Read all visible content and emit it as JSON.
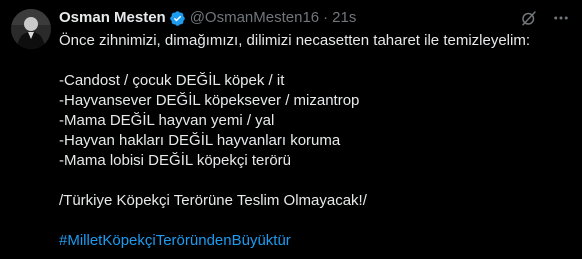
{
  "tweet": {
    "display_name": "Osman Mesten",
    "handle": "@OsmanMesten16",
    "separator": "·",
    "time": "21s",
    "lines": {
      "l1": "Önce zihnimizi, dimağımızı, dilimizi necasetten taharet ile temizleyelim:",
      "l2": "-Candost / çocuk DEĞİL köpek / it",
      "l3": "-Hayvansever DEĞİL köpeksever / mizantrop",
      "l4": "-Mama DEĞİL hayvan yemi / yal",
      "l5": "-Hayvan hakları DEĞİL hayvanları koruma",
      "l6": "-Mama lobisi DEĞİL köpekçi terörü",
      "l7": "/Türkiye Köpekçi Terörüne Teslim Olmayacak!/"
    },
    "hashtag": "#MilletKöpekçiTeröründenBüyüktür"
  },
  "icons": {
    "verified": "verified-badge-icon",
    "grok": "grok-icon",
    "more": "more-options-icon"
  },
  "colors": {
    "background": "#000000",
    "text": "#e7e9ea",
    "muted": "#71767b",
    "accent": "#1d9bf0"
  }
}
